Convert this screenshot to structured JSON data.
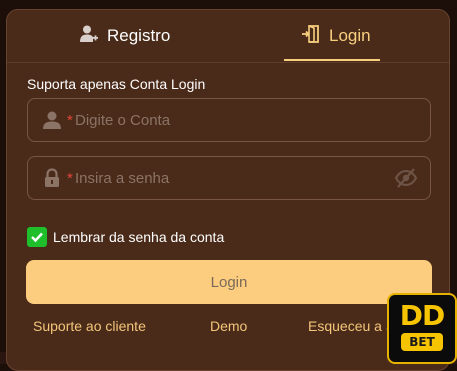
{
  "tabs": [
    {
      "label": "Registro",
      "icon": "add-user-icon",
      "active": false
    },
    {
      "label": "Login",
      "icon": "login-door-icon",
      "active": true
    }
  ],
  "hint": "Suporta apenas Conta Login",
  "fields": {
    "account": {
      "required_mark": "*",
      "placeholder": "Digite o Conta",
      "value": ""
    },
    "password": {
      "required_mark": "*",
      "placeholder": "Insira a senha",
      "value": ""
    }
  },
  "remember": {
    "label": "Lembrar da senha da conta",
    "checked": true
  },
  "login_button": {
    "label": "Login"
  },
  "footer_links": {
    "support": "Suporte ao cliente",
    "demo": "Demo",
    "forgot": "Esqueceu a S"
  },
  "logo": {
    "top": "DD",
    "bottom": "BET"
  },
  "colors": {
    "accent": "#f7cf7e",
    "button": "#fccd7e",
    "panel": "#4a2b1a",
    "check": "#1fbf2b",
    "required": "#e0463a"
  }
}
